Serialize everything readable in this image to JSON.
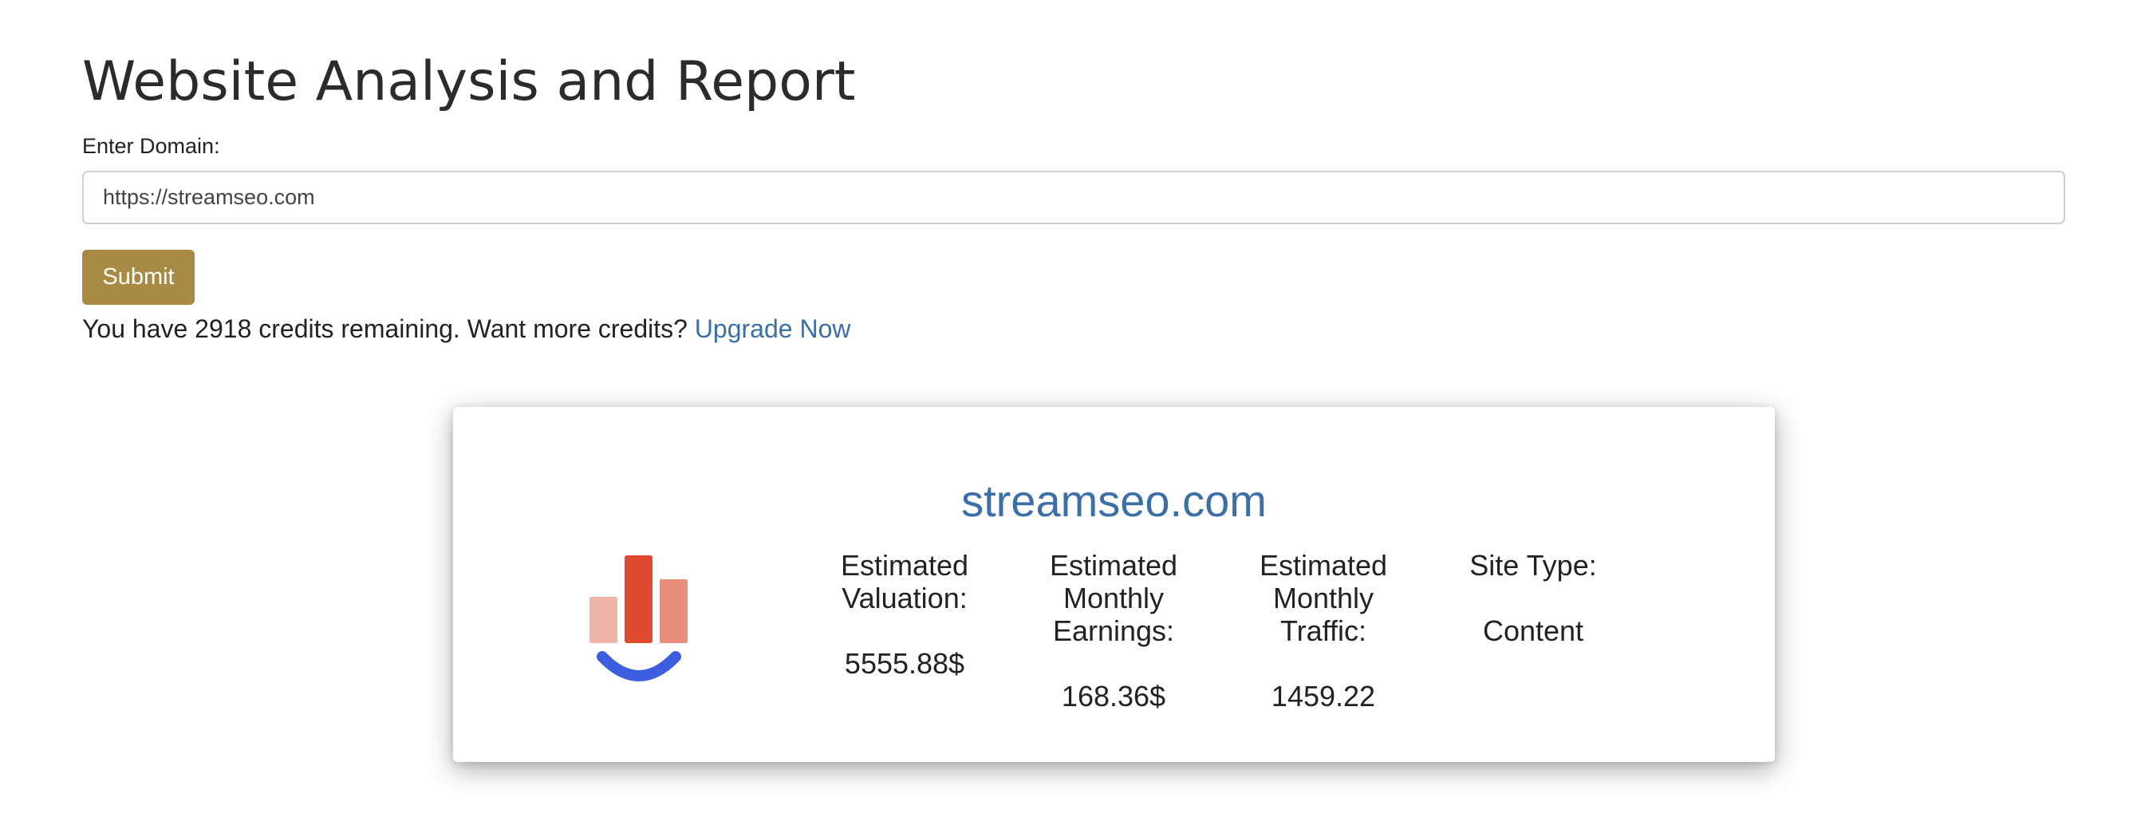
{
  "page": {
    "title": "Website Analysis and Report"
  },
  "form": {
    "domain_label": "Enter Domain:",
    "domain_value": "https://streamseo.com",
    "submit_label": "Submit"
  },
  "credits": {
    "message": "You have 2918 credits remaining. Want more credits?",
    "upgrade_link": "Upgrade Now"
  },
  "report": {
    "domain": "streamseo.com",
    "logo_icon": "streamseo-logo-icon",
    "stats": [
      {
        "label": "Estimated Valuation:",
        "value": "5555.88$"
      },
      {
        "label": "Estimated Monthly Earnings:",
        "value": "168.36$"
      },
      {
        "label": "Estimated Monthly Traffic:",
        "value": "1459.22"
      },
      {
        "label": "Site Type:",
        "value": "Content"
      }
    ]
  },
  "colors": {
    "accent_button": "#a88a45",
    "link": "#3a6fa8",
    "logo_bar_light": "#f0b5a8",
    "logo_bar_main": "#e04a30",
    "logo_bar_mid": "#e88e7a",
    "logo_smile": "#3e5ee0"
  }
}
